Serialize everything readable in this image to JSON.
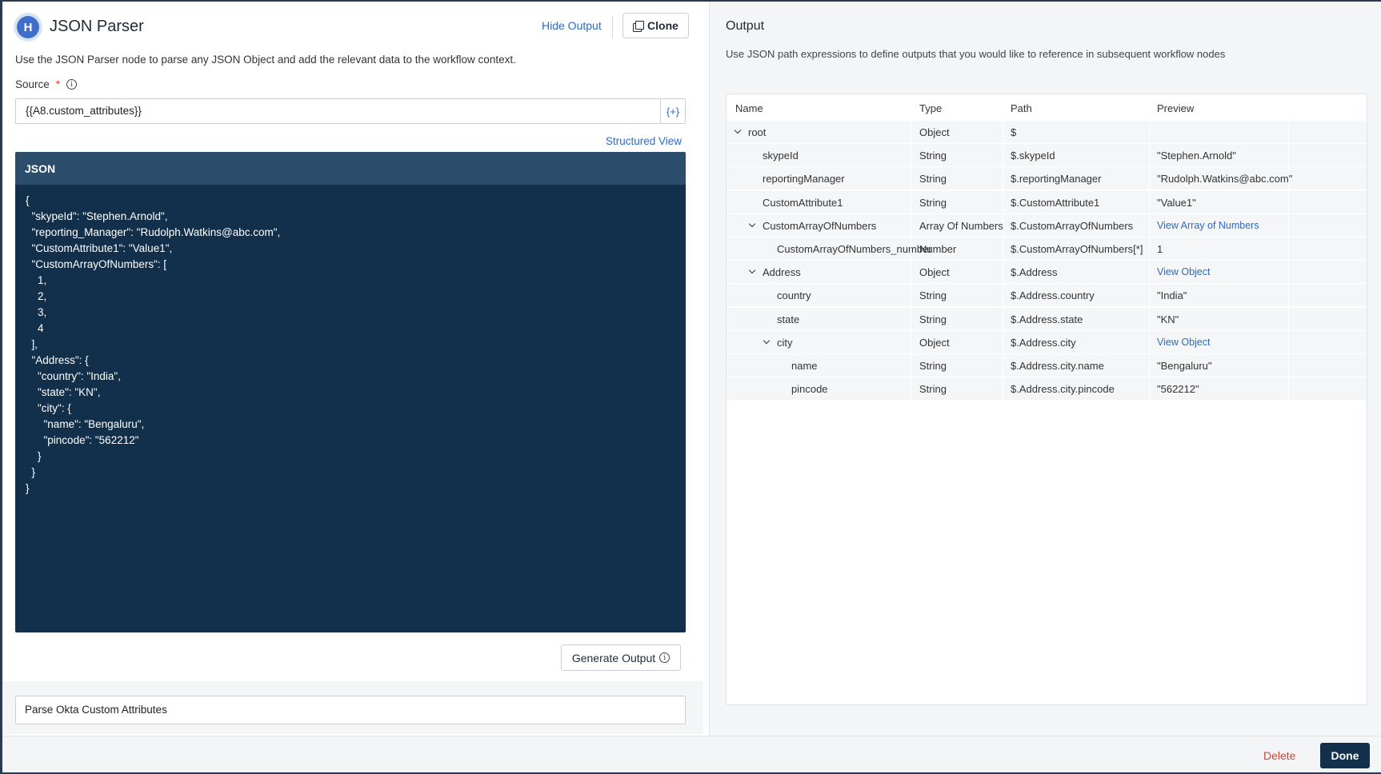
{
  "node": {
    "title": "JSON Parser",
    "logo_letter": "H",
    "hide_output_label": "Hide Output",
    "clone_label": "Clone",
    "description": "Use the JSON Parser node to parse any JSON Object and add the relevant data to the workflow context.",
    "source_label": "Source",
    "source_required_mark": "*",
    "source_value": "{{A8.custom_attributes}}",
    "insert_variable_label": "{+}",
    "structured_view_label": "Structured View",
    "json_header": "JSON",
    "json_text": "{\n  \"skypeId\": \"Stephen.Arnold\",\n  \"reporting_Manager\": \"Rudolph.Watkins@abc.com\",\n  \"CustomAttribute1\": \"Value1\",\n  \"CustomArrayOfNumbers\": [\n    1,\n    2,\n    3,\n    4\n  ],\n  \"Address\": {\n    \"country\": \"India\",\n    \"state\": \"KN\",\n    \"city\": {\n      \"name\": \"Bengaluru\",\n      \"pincode\": \"562212\"\n    }\n  }\n}",
    "generate_output_label": "Generate Output",
    "node_name_value": "Parse Okta Custom Attributes"
  },
  "output": {
    "title": "Output",
    "description": "Use JSON path expressions to define outputs that you would like to reference in subsequent workflow nodes",
    "columns": [
      "Name",
      "Type",
      "Path",
      "Preview"
    ],
    "rows": [
      {
        "name": "root",
        "type": "Object",
        "path": "$",
        "preview": "",
        "expandable": true,
        "depth": 0
      },
      {
        "name": "skypeId",
        "type": "String",
        "path": "$.skypeId",
        "preview": "\"Stephen.Arnold\"",
        "expandable": false,
        "depth": 1
      },
      {
        "name": "reportingManager",
        "type": "String",
        "path": "$.reportingManager",
        "preview": "\"Rudolph.Watkins@abc.com\"",
        "expandable": false,
        "depth": 1
      },
      {
        "name": "CustomAttribute1",
        "type": "String",
        "path": "$.CustomAttribute1",
        "preview": "\"Value1\"",
        "expandable": false,
        "depth": 1
      },
      {
        "name": "CustomArrayOfNumbers",
        "type": "Array Of Numbers",
        "path": "$.CustomArrayOfNumbers",
        "preview": "View Array of Numbers",
        "preview_is_link": true,
        "expandable": true,
        "depth": 1
      },
      {
        "name": "CustomArrayOfNumbers_number",
        "type": "Number",
        "path": "$.CustomArrayOfNumbers[*]",
        "preview": "1",
        "expandable": false,
        "depth": 2
      },
      {
        "name": "Address",
        "type": "Object",
        "path": "$.Address",
        "preview": "View Object",
        "preview_is_link": true,
        "expandable": true,
        "depth": 1
      },
      {
        "name": "country",
        "type": "String",
        "path": "$.Address.country",
        "preview": "\"India\"",
        "expandable": false,
        "depth": 2
      },
      {
        "name": "state",
        "type": "String",
        "path": "$.Address.state",
        "preview": "\"KN\"",
        "expandable": false,
        "depth": 2
      },
      {
        "name": "city",
        "type": "Object",
        "path": "$.Address.city",
        "preview": "View Object",
        "preview_is_link": true,
        "expandable": true,
        "depth": 2
      },
      {
        "name": "name",
        "type": "String",
        "path": "$.Address.city.name",
        "preview": "\"Bengaluru\"",
        "expandable": false,
        "depth": 3
      },
      {
        "name": "pincode",
        "type": "String",
        "path": "$.Address.city.pincode",
        "preview": "\"562212\"",
        "expandable": false,
        "depth": 3
      }
    ]
  },
  "footer": {
    "delete_label": "Delete",
    "done_label": "Done"
  },
  "colors": {
    "accent": "#2a6ac8",
    "json_bg": "#12304b",
    "json_header_bg": "#2d4d6d",
    "danger": "#d6402f"
  },
  "icons": [
    "clone-icon",
    "info-icon",
    "chevron-down-icon"
  ]
}
